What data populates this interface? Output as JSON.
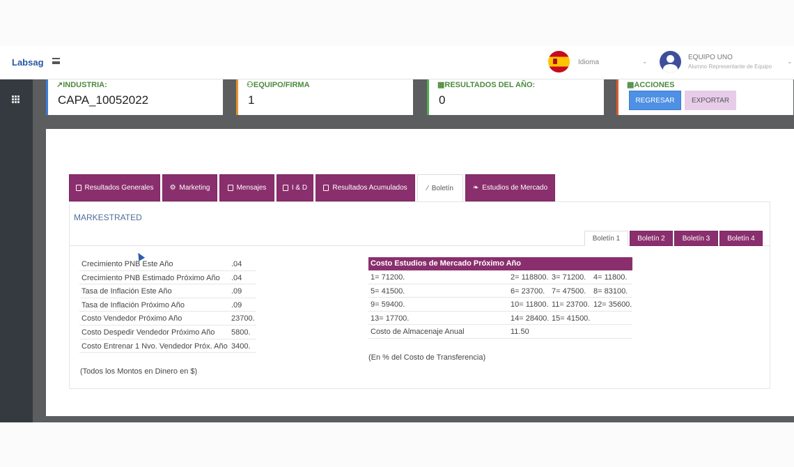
{
  "header": {
    "brand": "Labsag",
    "language_label": "Idioma",
    "user_name": "EQUIPO UNO",
    "user_role": "Alumno Representante de Equipo"
  },
  "cards": {
    "industria": {
      "title": "INDUSTRIA:",
      "value": "CAPA_10052022",
      "accent": "#3d7bd6"
    },
    "equipo": {
      "title": "EQUIPO/FIRMA",
      "value": "1",
      "accent": "#e5952a"
    },
    "resultados": {
      "title": "RESULTADOS DEL AÑO:",
      "value": "0",
      "accent": "#4caf50"
    },
    "acciones": {
      "title": "ACCIONES",
      "regresar": "REGRESAR",
      "exportar": "EXPORTAR",
      "accent": "#e05a2b"
    }
  },
  "tabs": [
    {
      "label": "Resultados Generales"
    },
    {
      "label": "Marketing"
    },
    {
      "label": "Mensajes"
    },
    {
      "label": "I & D"
    },
    {
      "label": "Resultados Acumulados"
    },
    {
      "label": "Boletín"
    },
    {
      "label": "Estudios de Mercado"
    }
  ],
  "section_title": "MARKESTRATED",
  "subtabs": [
    "Boletín 1",
    "Boletín 2",
    "Boletín 3",
    "Boletín 4"
  ],
  "left_table": [
    {
      "label": "Crecimiento PNB Este Año",
      "value": ".04"
    },
    {
      "label": "Crecimiento PNB Estimado Próximo Año",
      "value": ".04"
    },
    {
      "label": "Tasa de Inflación Este Año",
      "value": ".09"
    },
    {
      "label": "Tasa de Inflación Próximo Año",
      "value": ".09"
    },
    {
      "label": "Costo Vendedor Próximo Año",
      "value": "23700."
    },
    {
      "label": "Costo Despedir Vendedor Próximo Año",
      "value": "5800."
    },
    {
      "label": "Costo Entrenar 1 Nvo. Vendedor Próx. Año",
      "value": "3400."
    }
  ],
  "left_note": "(Todos los Montos en Dinero en $)",
  "right_table": {
    "header": "Costo Estudios de Mercado Próximo Año",
    "rows": [
      [
        "1= 71200.",
        "2= 118800.",
        "3= 71200.",
        "4= 11800."
      ],
      [
        "5= 41500.",
        "6= 23700.",
        "7= 47500.",
        "8= 83100."
      ],
      [
        "9= 59400.",
        "10= 11800.",
        "11= 23700.",
        "12= 35600."
      ],
      [
        "13= 17700.",
        "14= 28400.",
        "15= 41500.",
        ""
      ]
    ],
    "storage_label": "Costo de Almacenaje Anual",
    "storage_value": "11.50",
    "note": "(En % del Costo de Transferencia)"
  },
  "colors": {
    "tab_purple": "#8a2f6d",
    "brand_blue": "#2456a6",
    "regresar_blue": "#4e90e3",
    "exportar_pink": "#e7ccea"
  }
}
